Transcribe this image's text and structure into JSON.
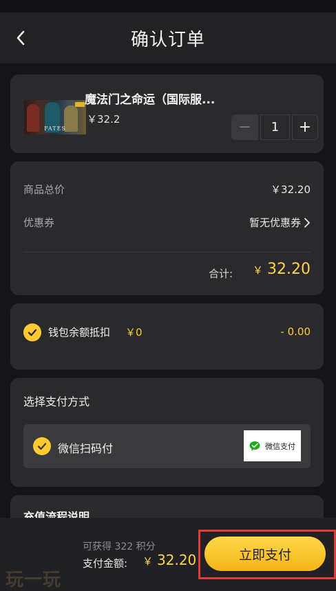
{
  "header": {
    "title": "确认订单"
  },
  "product": {
    "name": "魔法门之命运（国际服...",
    "price": "￥32.2",
    "quantity": "1",
    "minus_label": "−",
    "plus_label": "+",
    "thumbnail_text": "FATES"
  },
  "summary": {
    "subtotal_label": "商品总价",
    "subtotal_value": "￥32.20",
    "coupon_label": "优惠券",
    "coupon_value": "暂无优惠券",
    "total_label": "合计:",
    "total_currency": "￥",
    "total_value": "32.20"
  },
  "wallet": {
    "label": "钱包余额抵扣",
    "balance": "￥0",
    "deduction": "- 0.00",
    "checked": true
  },
  "payment": {
    "title": "选择支付方式",
    "option_label": "微信扫码付",
    "logo_text": "微信支付",
    "checked": true
  },
  "flow": {
    "title": "充值流程说明"
  },
  "footer": {
    "points": "可获得 322 积分",
    "pay_amount_label": "支付金额:",
    "pay_currency": "￥",
    "pay_amount": "32.20",
    "pay_button_label": "立即支付"
  },
  "watermark": "玩一玩",
  "colors": {
    "accent": "#ffcb30",
    "price_highlight": "#ffd34a",
    "background": "#151517",
    "card": "#2a2a2d",
    "highlight_box": "#e23b3b",
    "wechat_green": "#1aad19"
  },
  "icons": {
    "back": "chevron-left-icon",
    "coupon_arrow": "chevron-right-icon",
    "check": "check-circle-icon",
    "wechat": "wechat-pay-icon"
  }
}
